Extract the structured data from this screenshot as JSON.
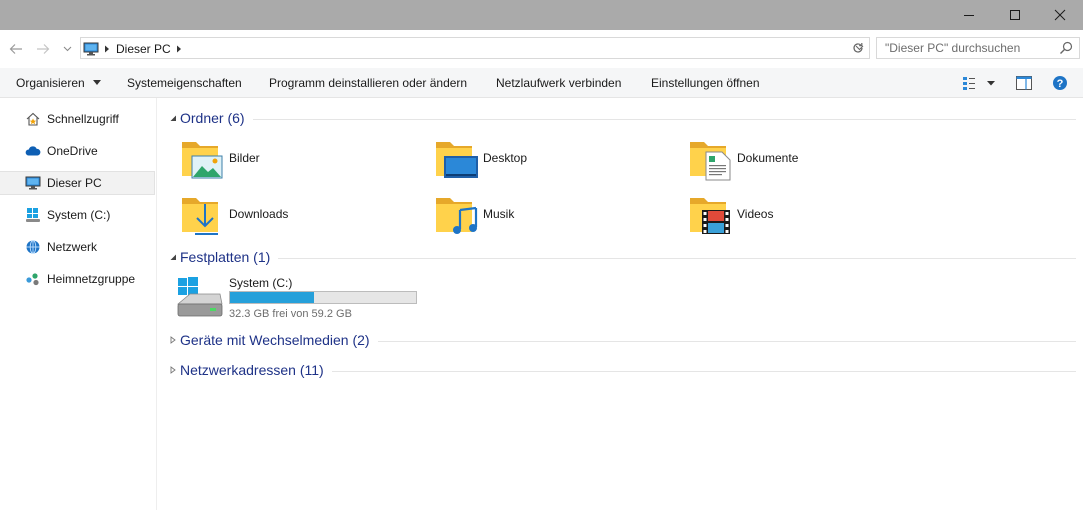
{
  "window": {
    "controls": [
      "minimize-icon",
      "maximize-icon",
      "close-icon"
    ]
  },
  "address": {
    "crumb": "Dieser PC",
    "search_placeholder": "\"Dieser PC\" durchsuchen"
  },
  "commands": [
    {
      "label": "Organisieren",
      "has_dropdown": true
    },
    {
      "label": "Systemeigenschaften"
    },
    {
      "label": "Programm deinstallieren oder ändern"
    },
    {
      "label": "Netzlaufwerk verbinden"
    },
    {
      "label": "Einstellungen öffnen"
    }
  ],
  "nav": [
    {
      "label": "Schnellzugriff",
      "icon": "quick-access-icon"
    },
    {
      "label": "OneDrive",
      "icon": "onedrive-icon"
    },
    {
      "label": "Dieser PC",
      "icon": "this-pc-icon",
      "selected": true
    },
    {
      "label": "System (C:)",
      "icon": "windows-drive-icon"
    },
    {
      "label": "Netzwerk",
      "icon": "network-icon"
    },
    {
      "label": "Heimnetzgruppe",
      "icon": "homegroup-icon"
    }
  ],
  "groups": {
    "folders_title": "Ordner (6)",
    "drives_title": "Festplatten (1)",
    "removable_title": "Geräte mit Wechselmedien (2)",
    "network_title": "Netzwerkadressen (11)"
  },
  "folders": [
    {
      "label": "Bilder",
      "icon": "pictures-folder-icon"
    },
    {
      "label": "Desktop",
      "icon": "desktop-folder-icon"
    },
    {
      "label": "Dokumente",
      "icon": "documents-folder-icon"
    },
    {
      "label": "Downloads",
      "icon": "downloads-folder-icon"
    },
    {
      "label": "Musik",
      "icon": "music-folder-icon"
    },
    {
      "label": "Videos",
      "icon": "videos-folder-icon"
    }
  ],
  "drive": {
    "name": "System (C:)",
    "free_text": "32.3 GB frei von 59.2 GB",
    "used_fraction": 0.454
  },
  "colors": {
    "group_title": "#1e3287",
    "bar_fill": "#26a0da",
    "folder_yellow": "#ffd24b",
    "titlebar": "#aaaaaa"
  }
}
